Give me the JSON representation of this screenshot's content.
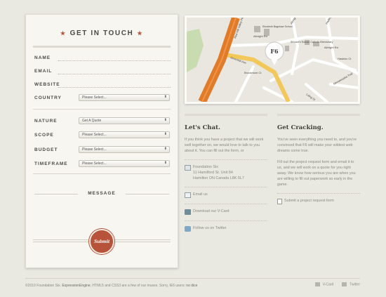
{
  "form": {
    "title": "GET IN TOUCH",
    "fields": {
      "name": "NAME",
      "email": "EMAIL",
      "website": "WEBSITE",
      "country": "COUNTRY",
      "nature": "NATURE",
      "scope": "SCOPE",
      "budget": "BUDGET",
      "timeframe": "TIMEFRAME"
    },
    "selects": {
      "country": "Please Select...",
      "nature": "Get A Quote",
      "scope": "Please Select...",
      "budget": "Please Select...",
      "timeframe": "Please Select..."
    },
    "message_label": "MESSAGE",
    "submit_label": "Submit"
  },
  "map": {
    "marker": "F6",
    "streets": {
      "red_hill": "Red Hill Valley Pkwy",
      "greenhill": "Greenhill Ave",
      "brookmont": "Brookmont Ct",
      "albright_1": "Albright Rd",
      "albright_2": "Albright Rd",
      "albright_3": "Albright Rd",
      "hadley": "Hadley St",
      "haskins": "Haskins Ct",
      "laing": "Laing St",
      "minnewaska": "Minnewaska Trail",
      "school": "Elizabeth Bagshaw School",
      "church": "St Luke's Roman Catholic Elementary"
    }
  },
  "chat": {
    "title": "Let's Chat.",
    "intro": "If you think you have a project that we will work well together on, we would love to talk to you about it. You can fill out the form, or",
    "address_line1": "Foundation Six",
    "address_line2": "11 Hamilford St. Unit 84",
    "address_line3": "Hamilton ON Canada L8K 5L7",
    "email": "Email us",
    "vcard": "Download our V-Card",
    "twitter": "Follow us on Twitter"
  },
  "cracking": {
    "title": "Get Cracking.",
    "p1": "You've seen everything you need to, and you're convinced that F6 will make your wildest web dreams come true.",
    "p2": "Fill out the project request form and email it to us, and we will work on a quote for you right away. We know how serious you are when you are willing to fill out paperwork so early in the game.",
    "link": "Submit a project request form"
  },
  "footer": {
    "text_a": "©2010 Foundation Six.",
    "ee": "ExpressionEngine",
    "text_b": ", HTML5 and CSS3 are a few of our muses. Sorry, IE6 users: ",
    "nodice": "no dice",
    "vcard": "V-Card",
    "twitter": "Twitter"
  },
  "colors": {
    "accent": "#b6533a",
    "background": "#e9e8e1",
    "card": "#f7f6f1",
    "road_orange": "#e07b2a",
    "road_yellow": "#f2c85b"
  }
}
